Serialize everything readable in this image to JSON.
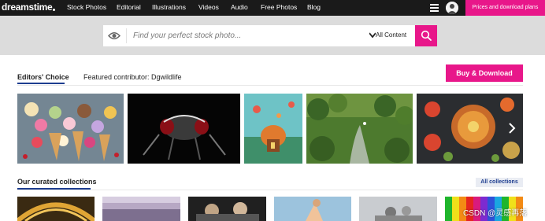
{
  "brand": {
    "logo_text": "dreamstime"
  },
  "nav": {
    "links": [
      "Stock Photos",
      "Editorial",
      "Illustrations",
      "Videos",
      "Audio",
      "Free Photos",
      "Blog"
    ],
    "menu_icon": "hamburger-icon",
    "avatar_icon": "user-avatar",
    "cta": "Prices and download plans"
  },
  "search": {
    "placeholder": "Find your perfect stock photo...",
    "filter_label": "All Content",
    "search_icon": "search-icon",
    "visual_search_icon": "eye-icon"
  },
  "editors": {
    "tabs": [
      "Editors' Choice",
      "Featured contributor: Dgwildlife"
    ],
    "active_tab": 0,
    "buy_label": "Buy & Download",
    "next_icon": "chevron-right-icon"
  },
  "curated": {
    "title": "Our curated collections",
    "all_label": "All collections"
  },
  "watermark": "CSDN @灵感再落",
  "colors": {
    "accent": "#e8178a",
    "nav_bg": "#1a1a1a",
    "link_blue": "#1d3d8f"
  }
}
